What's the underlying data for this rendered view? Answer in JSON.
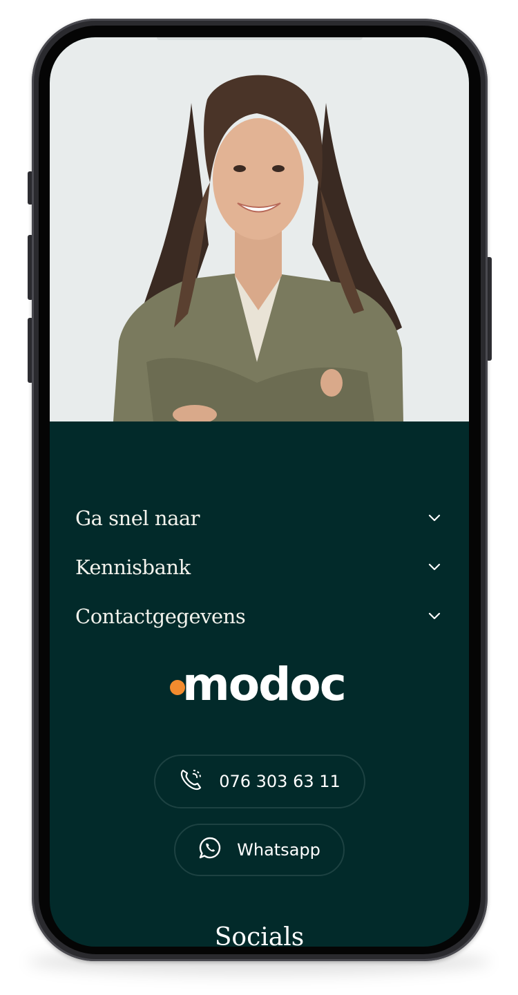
{
  "menu": {
    "items": [
      {
        "label": "Ga snel naar"
      },
      {
        "label": "Kennisbank"
      },
      {
        "label": "Contactgegevens"
      }
    ]
  },
  "logo": {
    "text": "modoc",
    "accent_color": "#f28b2e"
  },
  "contact": {
    "phone_label": "076 303 63 11",
    "whatsapp_label": "Whatsapp"
  },
  "socials": {
    "heading": "Socials"
  },
  "colors": {
    "background": "#022a2a",
    "hero_background": "#e8ecec",
    "text": "#f2f2ec"
  },
  "icons": {
    "chevron": "chevron-down-icon",
    "phone": "phone-call-icon",
    "whatsapp": "whatsapp-icon"
  }
}
